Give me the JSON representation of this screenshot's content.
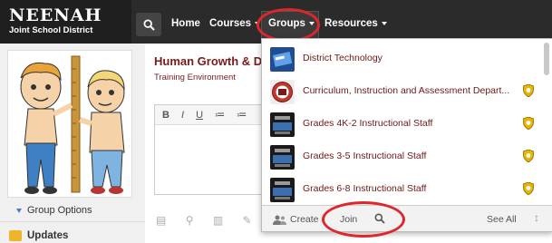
{
  "brand": {
    "name": "NEENAH",
    "subtitle": "Joint School District"
  },
  "nav": {
    "home": "Home",
    "courses": "Courses",
    "groups": "Groups",
    "resources": "Resources"
  },
  "sidebar": {
    "group_options": "Group Options",
    "updates": "Updates"
  },
  "main": {
    "title": "Human Growth & D",
    "subtitle": "Training Environment",
    "editor_toolbar": [
      "B",
      "I",
      "U",
      "≔",
      "≔"
    ]
  },
  "groups_menu": {
    "items": [
      {
        "label": "District Technology",
        "icon": "tech-thumb",
        "badge": false
      },
      {
        "label": "Curriculum, Instruction and Assessment Depart...",
        "icon": "curriculum-thumb",
        "badge": true
      },
      {
        "label": "Grades 4K-2 Instructional Staff",
        "icon": "staff-thumb",
        "badge": true
      },
      {
        "label": "Grades 3-5 Instructional Staff",
        "icon": "staff-thumb",
        "badge": true
      },
      {
        "label": "Grades 6-8 Instructional Staff",
        "icon": "staff-thumb",
        "badge": true
      }
    ],
    "footer": {
      "create": "Create",
      "join": "Join",
      "see_all": "See All"
    }
  },
  "colors": {
    "topbar": "#2b2b2b",
    "accent_red": "#e0262c",
    "maroon_text": "#6e1717",
    "badge_gold": "#e8b400"
  }
}
